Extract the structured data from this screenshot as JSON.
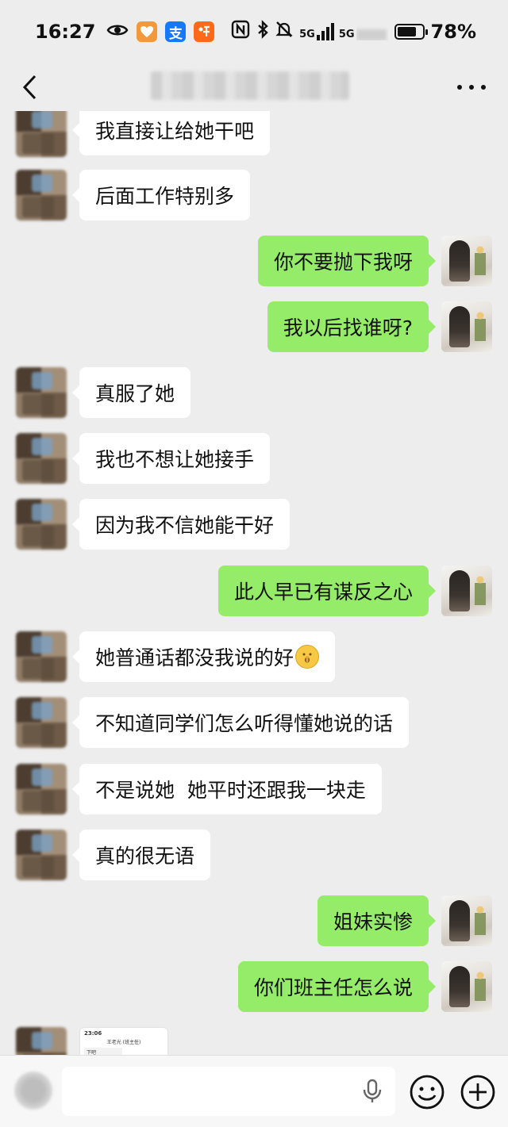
{
  "status_bar": {
    "time": "16:27",
    "alipay_glyph": "支",
    "network_label": "5G",
    "battery_percent_label": "78%",
    "battery_level": 0.78,
    "icons": [
      "eye-icon",
      "health-app-icon",
      "alipay-icon",
      "taobao-icon",
      "nfc-icon",
      "bluetooth-icon",
      "mute-icon",
      "signal-icon",
      "battery-icon"
    ]
  },
  "header": {
    "title": "",
    "back_icon": "chevron-left-icon",
    "more_icon": "more-dots-icon"
  },
  "messages": [
    {
      "side": "left",
      "text": "我直接让给她干吧"
    },
    {
      "side": "left",
      "text": "后面工作特别多"
    },
    {
      "side": "right",
      "text": "你不要抛下我呀"
    },
    {
      "side": "right",
      "text": "我以后找谁呀?"
    },
    {
      "side": "left",
      "text": "真服了她"
    },
    {
      "side": "left",
      "text": "我也不想让她接手"
    },
    {
      "side": "left",
      "text": "因为我不信她能干好"
    },
    {
      "side": "right",
      "text": "此人早已有谋反之心"
    },
    {
      "side": "left",
      "text": "她普通话都没我说的好",
      "emoji": "shushing-face"
    },
    {
      "side": "left",
      "text": "不知道同学们怎么听得懂她说的话"
    },
    {
      "side": "left",
      "text": "不是说她  她平时还跟我一块走"
    },
    {
      "side": "left",
      "text": "真的很无语"
    },
    {
      "side": "right",
      "text": "姐妹实惨"
    },
    {
      "side": "right",
      "text": "你们班主任怎么说"
    }
  ],
  "image_message": {
    "side": "left",
    "screenshot_time": "23:06",
    "screenshot_title": "王老光 (班主任)",
    "screenshot_msg": "下吧"
  },
  "input_bar": {
    "placeholder": "",
    "icons": [
      "voice-icon",
      "mic-icon",
      "emoji-icon",
      "plus-icon"
    ]
  },
  "colors": {
    "background": "#ededed",
    "self_bubble": "#95ec69",
    "other_bubble": "#ffffff"
  }
}
